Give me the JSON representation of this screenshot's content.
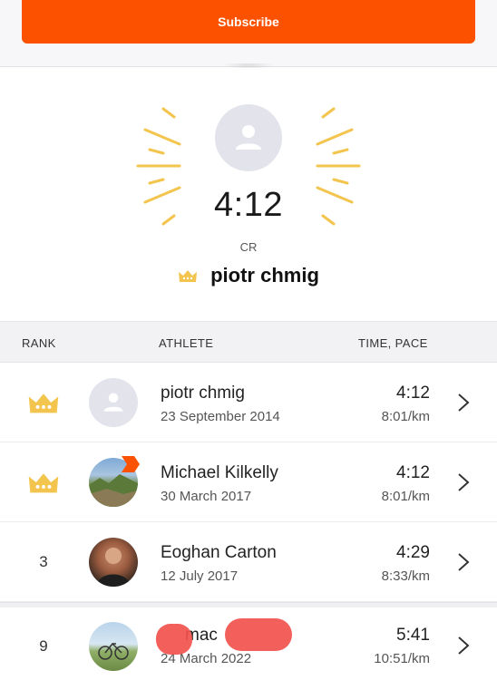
{
  "subscribe": {
    "label": "Subscribe"
  },
  "leader": {
    "time": "4:12",
    "badge": "CR",
    "name": "piotr chmig"
  },
  "table": {
    "headers": {
      "rank": "RANK",
      "athlete": "ATHLETE",
      "time": "TIME, PACE"
    },
    "rows": [
      {
        "rank": "",
        "crown": true,
        "name": "piotr chmig",
        "date": "23 September 2014",
        "time": "4:12",
        "pace": "8:01/km",
        "avatar": "default-avatar"
      },
      {
        "rank": "",
        "crown": true,
        "name": "Michael Kilkelly",
        "date": "30 March 2017",
        "time": "4:12",
        "pace": "8:01/km",
        "avatar": "landscape-photo"
      },
      {
        "rank": "3",
        "crown": false,
        "name": "Eoghan Carton",
        "date": "12 July 2017",
        "time": "4:29",
        "pace": "8:33/km",
        "avatar": "portrait-photo"
      },
      {
        "rank": "9",
        "crown": false,
        "name": "mac",
        "date": "24 March 2022",
        "time": "5:41",
        "pace": "10:51/km",
        "avatar": "bike-photo"
      }
    ]
  },
  "colors": {
    "accent": "#fc5200",
    "crown": "#f3c54e",
    "redaction": "#f2524e"
  }
}
